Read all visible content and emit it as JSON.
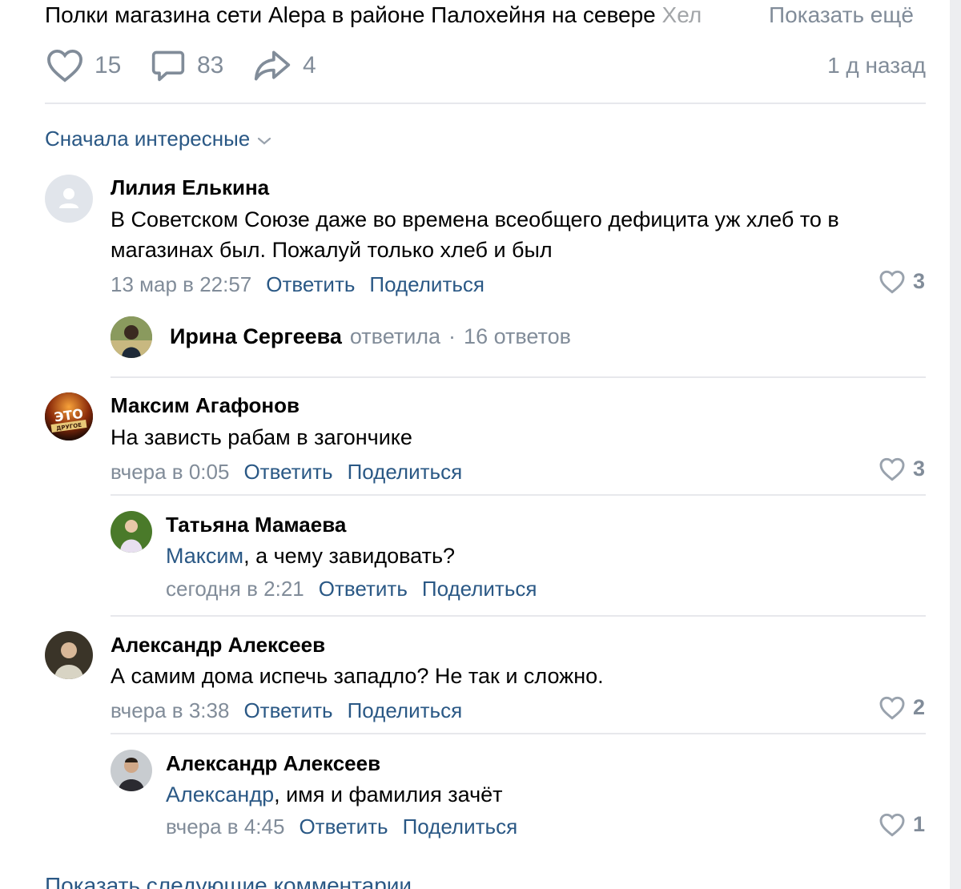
{
  "post": {
    "text_main": "Полки магазина сети Alepa в районе Палохейня на севере ",
    "text_fade": "Хел",
    "show_more": "Показать ещё",
    "likes": "15",
    "comments": "83",
    "shares": "4",
    "time_ago": "1 д назад"
  },
  "sort": {
    "label": "Сначала интересные"
  },
  "comments": [
    {
      "author": "Лилия Елькина",
      "text": "В Советском Союзе даже во времена всеобщего дефицита уж хлеб то в магазинах был. Пожалуй только хлеб и был",
      "date": "13 мар в 22:57",
      "reply": "Ответить",
      "share": "Поделиться",
      "likes": "3",
      "thread": {
        "author": "Ирина Сергеева",
        "verb": "ответила",
        "sep": "·",
        "count": "16 ответов"
      }
    },
    {
      "author": "Максим Агафонов",
      "text": "На зависть рабам в загончике",
      "date": "вчера в 0:05",
      "reply": "Ответить",
      "share": "Поделиться",
      "likes": "3",
      "avatar_text": "ЭТО",
      "avatar_subtext": "ДРУГОЕ",
      "replies": [
        {
          "author": "Татьяна Мамаева",
          "mention": "Максим",
          "text": ", а чему завидовать?",
          "date": "сегодня в 2:21",
          "reply": "Ответить",
          "share": "Поделиться"
        }
      ]
    },
    {
      "author": "Александр Алексеев",
      "text": "А самим дома испечь западло? Не так и сложно.",
      "date": "вчера в 3:38",
      "reply": "Ответить",
      "share": "Поделиться",
      "likes": "2",
      "replies": [
        {
          "author": "Александр Алексеев",
          "mention": "Александр",
          "text": ", имя и фамилия зачёт",
          "date": "вчера в 4:45",
          "reply": "Ответить",
          "share": "Поделиться",
          "likes": "1"
        }
      ]
    }
  ],
  "footer": {
    "show_next": "Показать следующие комментарии"
  },
  "colors": {
    "link": "#2a5885",
    "muted": "#818c99",
    "divider": "#e7e8ec",
    "background": "#edeef0"
  },
  "icons": {
    "like": "heart-icon",
    "comment": "speech-bubble-icon",
    "share": "share-arrow-icon",
    "sort": "chevron-down-icon"
  }
}
